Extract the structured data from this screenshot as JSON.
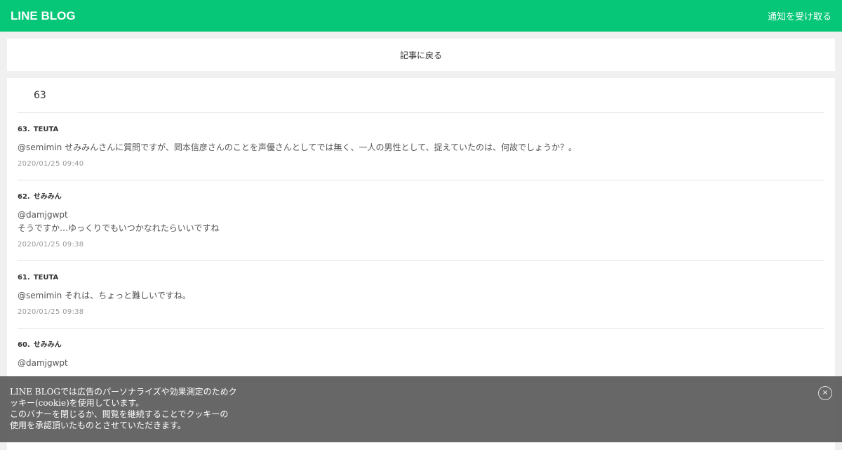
{
  "header": {
    "logo": "LINE BLOG",
    "notify_label": "通知を受け取る"
  },
  "back_bar": {
    "label": "記事に戻る"
  },
  "comments": {
    "count": "63",
    "items": [
      {
        "number": "63.",
        "author": "TEUTA",
        "lines": [
          "@semimin せみみんさんに質問ですが、岡本信彦さんのことを声優さんとしてでは無く、一人の男性として、捉えていたのは、何故でしょうか？。"
        ],
        "date": "2020/01/25 09:40"
      },
      {
        "number": "62.",
        "author": "せみみん",
        "lines": [
          "@damjgwpt",
          "そうですか…ゆっくりでもいつかなれたらいいですね"
        ],
        "date": "2020/01/25 09:38"
      },
      {
        "number": "61.",
        "author": "TEUTA",
        "lines": [
          "@semimin それは、ちょっと難しいですね。"
        ],
        "date": "2020/01/25 09:38"
      },
      {
        "number": "60.",
        "author": "せみみん",
        "lines": [
          "@damjgwpt"
        ],
        "date": ""
      }
    ]
  },
  "cookie_banner": {
    "lines": [
      "LINE BLOGでは広告のパーソナライズや効果測定のためク",
      "ッキー(cookie)を使用しています。",
      "このバナーを閉じるか、閲覧を継続することでクッキーの",
      "使用を承認頂いたものとさせていただきます。"
    ],
    "close_symbol": "×"
  }
}
